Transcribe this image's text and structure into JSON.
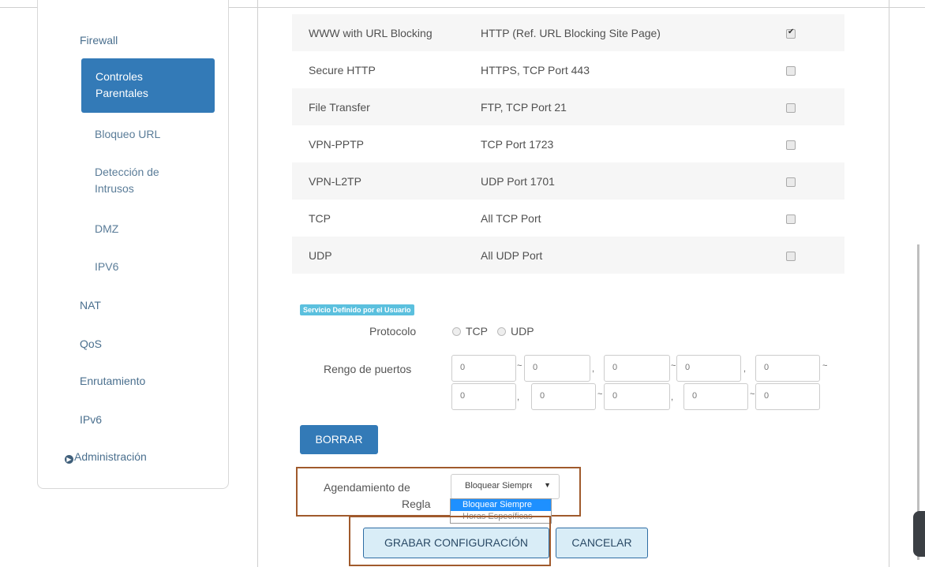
{
  "sidebar": {
    "firewall": "Firewall",
    "parental": "Controles Parentales",
    "url_block": "Bloqueo URL",
    "intrusion": "Detección de Intrusos",
    "dmz": "DMZ",
    "ipv6_sub": "IPV6",
    "nat": "NAT",
    "qos": "QoS",
    "routing": "Enrutamiento",
    "ipv6": "IPv6",
    "admin": "Administración"
  },
  "services": [
    {
      "name": "WWW with URL Blocking",
      "detail": "HTTP (Ref. URL Blocking Site Page)",
      "checked": true
    },
    {
      "name": "Secure HTTP",
      "detail": "HTTPS, TCP Port 443",
      "checked": false
    },
    {
      "name": "File Transfer",
      "detail": "FTP, TCP Port 21",
      "checked": false
    },
    {
      "name": "VPN-PPTP",
      "detail": "TCP Port 1723",
      "checked": false
    },
    {
      "name": "VPN-L2TP",
      "detail": "UDP Port 1701",
      "checked": false
    },
    {
      "name": "TCP",
      "detail": "All TCP Port",
      "checked": false
    },
    {
      "name": "UDP",
      "detail": "All UDP Port",
      "checked": false
    }
  ],
  "user_service": {
    "tag": "Servicio Definido por el Usuario",
    "protocol_label": "Protocolo",
    "tcp": "TCP",
    "udp": "UDP",
    "port_range_label": "Rengo de puertos",
    "ports": [
      "0",
      "0",
      "0",
      "0",
      "0",
      "0",
      "0",
      "0",
      "0",
      "0"
    ],
    "range_sep": "~",
    "list_sep": ","
  },
  "buttons": {
    "borrar": "BORRAR",
    "save": "GRABAR CONFIGURACIÓN",
    "cancel": "CANCELAR"
  },
  "schedule": {
    "label_line1": "Agendamiento de",
    "label_line2": "Regla",
    "selected": "Bloquear Siempre",
    "options": [
      "Bloquear Siempre",
      "Horas Específicas"
    ]
  },
  "colors": {
    "primary": "#337ab7",
    "highlight_box": "#a05a2c",
    "tag": "#5bc0de"
  }
}
